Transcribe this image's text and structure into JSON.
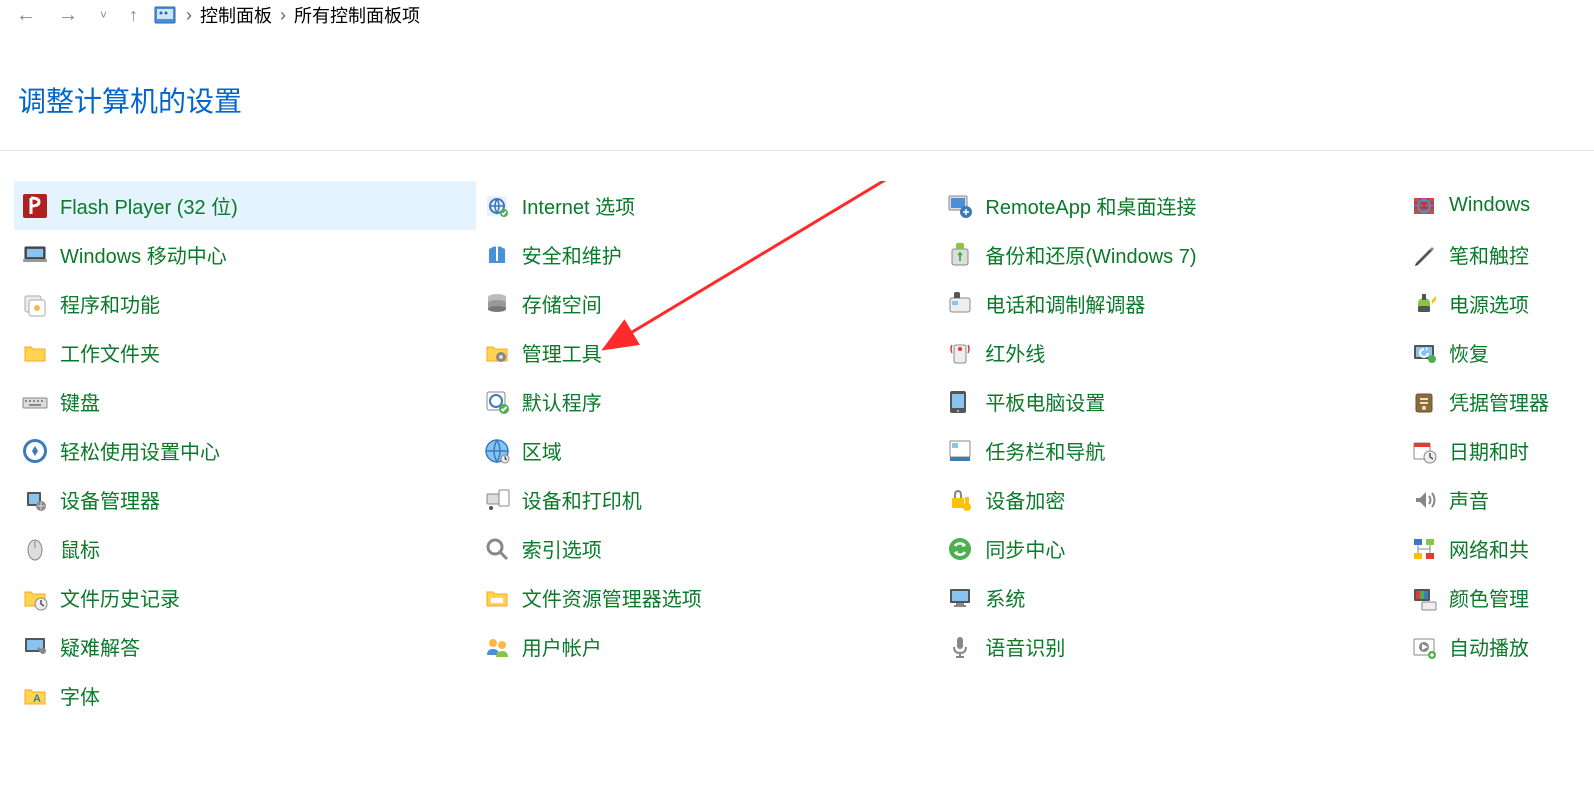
{
  "nav": {
    "breadcrumb": [
      "控制面板",
      "所有控制面板项"
    ]
  },
  "header": {
    "title": "调整计算机的设置"
  },
  "items": [
    [
      {
        "icon": "flash",
        "label": "Flash Player (32 位)",
        "hovered": true
      },
      {
        "icon": "internet",
        "label": "Internet 选项"
      },
      {
        "icon": "remoteapp",
        "label": "RemoteApp 和桌面连接"
      },
      {
        "icon": "firewall",
        "label": "Windows"
      }
    ],
    [
      {
        "icon": "mobility",
        "label": "Windows 移动中心"
      },
      {
        "icon": "security",
        "label": "安全和维护"
      },
      {
        "icon": "backup",
        "label": "备份和还原(Windows 7)"
      },
      {
        "icon": "pen",
        "label": "笔和触控"
      }
    ],
    [
      {
        "icon": "programs",
        "label": "程序和功能"
      },
      {
        "icon": "storage",
        "label": "存储空间"
      },
      {
        "icon": "phone",
        "label": "电话和调制解调器"
      },
      {
        "icon": "power",
        "label": "电源选项"
      }
    ],
    [
      {
        "icon": "workfolders",
        "label": "工作文件夹"
      },
      {
        "icon": "admintools",
        "label": "管理工具"
      },
      {
        "icon": "infrared",
        "label": "红外线"
      },
      {
        "icon": "recovery",
        "label": "恢复"
      }
    ],
    [
      {
        "icon": "keyboard",
        "label": "键盘"
      },
      {
        "icon": "defaultprograms",
        "label": "默认程序"
      },
      {
        "icon": "tablet",
        "label": "平板电脑设置"
      },
      {
        "icon": "credentials",
        "label": "凭据管理器"
      }
    ],
    [
      {
        "icon": "easeofaccess",
        "label": "轻松使用设置中心"
      },
      {
        "icon": "region",
        "label": "区域"
      },
      {
        "icon": "taskbar",
        "label": "任务栏和导航"
      },
      {
        "icon": "datetime",
        "label": "日期和时"
      }
    ],
    [
      {
        "icon": "devicemanager",
        "label": "设备管理器"
      },
      {
        "icon": "devices",
        "label": "设备和打印机"
      },
      {
        "icon": "encryption",
        "label": "设备加密"
      },
      {
        "icon": "sound",
        "label": "声音"
      }
    ],
    [
      {
        "icon": "mouse",
        "label": "鼠标"
      },
      {
        "icon": "indexing",
        "label": "索引选项"
      },
      {
        "icon": "sync",
        "label": "同步中心"
      },
      {
        "icon": "network",
        "label": "网络和共"
      }
    ],
    [
      {
        "icon": "filehistory",
        "label": "文件历史记录"
      },
      {
        "icon": "explorer",
        "label": "文件资源管理器选项"
      },
      {
        "icon": "system",
        "label": "系统"
      },
      {
        "icon": "color",
        "label": "颜色管理"
      }
    ],
    [
      {
        "icon": "troubleshoot",
        "label": "疑难解答"
      },
      {
        "icon": "users",
        "label": "用户帐户"
      },
      {
        "icon": "speech",
        "label": "语音识别"
      },
      {
        "icon": "autoplay",
        "label": "自动播放"
      }
    ],
    [
      {
        "icon": "fonts",
        "label": "字体"
      }
    ]
  ]
}
